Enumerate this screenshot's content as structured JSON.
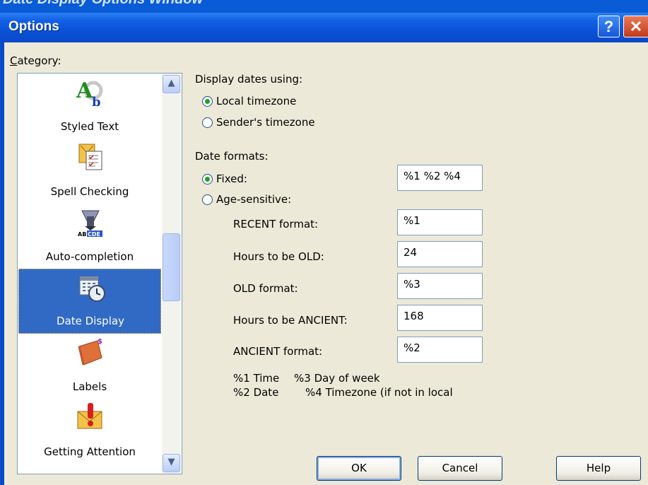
{
  "cut_title": "Date Display Options Window",
  "window": {
    "title": "Options",
    "help_glyph": "?",
    "close_glyph": "✕"
  },
  "category": {
    "label": "Category:",
    "items": [
      {
        "label": "Styled Text",
        "icon": "styled-text-icon"
      },
      {
        "label": "Spell Checking",
        "icon": "spell-checking-icon"
      },
      {
        "label": "Auto-completion",
        "icon": "auto-completion-icon"
      },
      {
        "label": "Date Display",
        "icon": "date-display-icon",
        "selected": true
      },
      {
        "label": "Labels",
        "icon": "labels-icon"
      },
      {
        "label": "Getting Attention",
        "icon": "getting-attention-icon"
      }
    ]
  },
  "display_dates": {
    "heading": "Display dates using:",
    "options": [
      "Local timezone",
      "Sender's timezone"
    ],
    "selected": "Local timezone"
  },
  "date_formats": {
    "heading": "Date formats:",
    "fixed_label": "Fixed:",
    "fixed_value": "%1 %2 %4",
    "age_label": "Age-sensitive:",
    "selected": "Fixed:",
    "recent_label": "RECENT format:",
    "recent_value": "%1",
    "hours_old_label": "Hours to be OLD:",
    "hours_old_value": "24",
    "old_label": "OLD format:",
    "old_value": "%3",
    "hours_ancient_label": "Hours to be ANCIENT:",
    "hours_ancient_value": "168",
    "ancient_label": "ANCIENT format:",
    "ancient_value": "%2"
  },
  "legend": {
    "time": "%1 Time",
    "day": "%3 Day of week",
    "date": "%2 Date",
    "tz": "%4 Timezone (if not in local"
  },
  "buttons": {
    "ok": "OK",
    "cancel": "Cancel",
    "help": "Help"
  }
}
